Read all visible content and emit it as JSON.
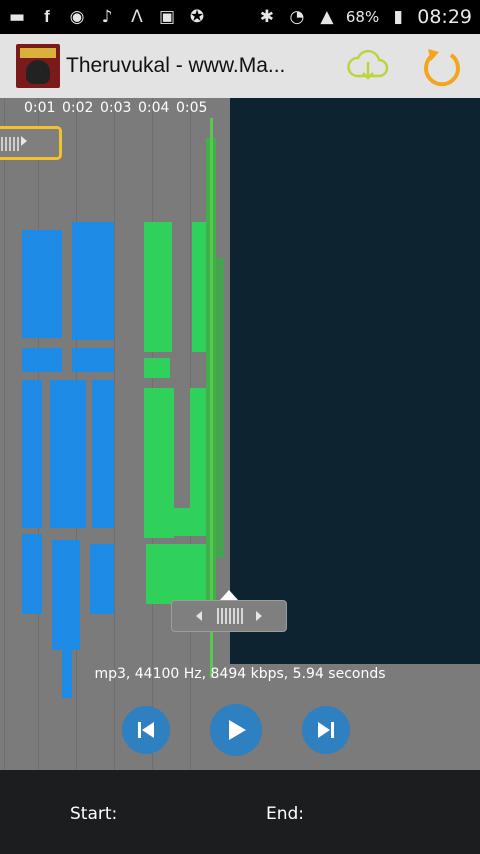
{
  "status_bar": {
    "battery": "68%",
    "time": "08:29",
    "icons": [
      "chat-icon",
      "facebook-icon",
      "whatsapp-icon",
      "music-note-icon",
      "triangle-logo-icon",
      "photo-icon",
      "star-icon",
      "bluetooth-icon",
      "wifi-icon",
      "signal-icon",
      "battery-icon"
    ]
  },
  "action_bar": {
    "title": "Theruvukal - www.Ma...",
    "cloud_color": "#bcd43a",
    "reload_color": "#f2a51d"
  },
  "timeline": {
    "labels": [
      "0:01",
      "0:02",
      "0:03",
      "0:04",
      "0:05"
    ]
  },
  "waveform": {
    "info": "mp3, 44100 Hz, 8494 kbps, 5.94 seconds",
    "colors": {
      "background": "#7b7b7b",
      "selection_outside": "#0d232f",
      "blue": "#1e8ce6",
      "green": "#2fd15a",
      "accent": "#2f80c0",
      "handle_border": "#f2c12e"
    }
  },
  "bottom_bar": {
    "start_label": "Start:",
    "end_label": "End:"
  }
}
